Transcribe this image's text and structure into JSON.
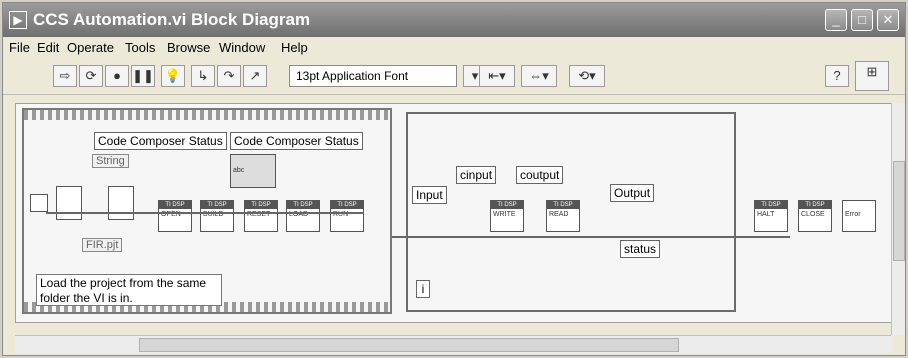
{
  "window": {
    "title": "CCS Automation.vi Block Diagram"
  },
  "menu": [
    "File",
    "Edit",
    "Operate",
    "Tools",
    "Browse",
    "Window",
    "Help"
  ],
  "toolbar": {
    "font": "13pt Application Font"
  },
  "diagram": {
    "status_labels": [
      "Code Composer Status",
      "Code Composer Status"
    ],
    "string_const": "String",
    "abc_label": "abc",
    "fir_file": "FIR.pjt",
    "comment": "Load the project from the same folder the VI is in.",
    "io": {
      "input": "Input",
      "cinput": "cinput",
      "coutput": "coutput",
      "output": "Output",
      "status": "status",
      "iter": "i"
    },
    "vis": [
      {
        "top": "TI DSP",
        "txt": "OPEN"
      },
      {
        "top": "TI DSP",
        "txt": "BUILD"
      },
      {
        "top": "TI DSP",
        "txt": "RESET"
      },
      {
        "top": "TI DSP",
        "txt": "LOAD"
      },
      {
        "top": "TI DSP",
        "txt": "RUN"
      },
      {
        "top": "TI DSP",
        "txt": "WRITE"
      },
      {
        "top": "TI DSP",
        "txt": "READ"
      },
      {
        "top": "TI DSP",
        "txt": "HALT"
      },
      {
        "top": "TI DSP",
        "txt": "CLOSE"
      }
    ],
    "error_label": "Error"
  }
}
